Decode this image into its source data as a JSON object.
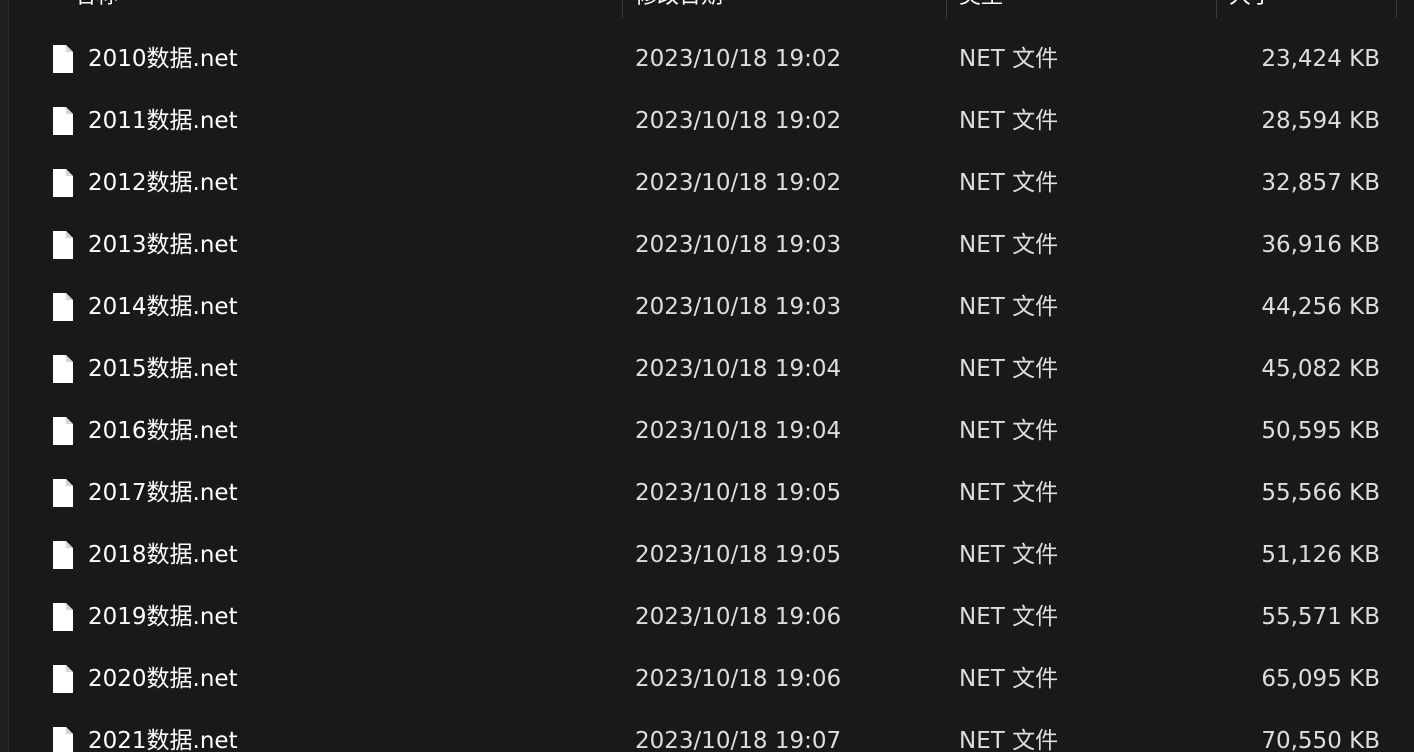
{
  "columns": {
    "name": "名称",
    "date": "修改日期",
    "type": "类型",
    "size": "大小"
  },
  "files": [
    {
      "name": "2010数据.net",
      "date": "2023/10/18 19:02",
      "type": "NET 文件",
      "size": "23,424 KB"
    },
    {
      "name": "2011数据.net",
      "date": "2023/10/18 19:02",
      "type": "NET 文件",
      "size": "28,594 KB"
    },
    {
      "name": "2012数据.net",
      "date": "2023/10/18 19:02",
      "type": "NET 文件",
      "size": "32,857 KB"
    },
    {
      "name": "2013数据.net",
      "date": "2023/10/18 19:03",
      "type": "NET 文件",
      "size": "36,916 KB"
    },
    {
      "name": "2014数据.net",
      "date": "2023/10/18 19:03",
      "type": "NET 文件",
      "size": "44,256 KB"
    },
    {
      "name": "2015数据.net",
      "date": "2023/10/18 19:04",
      "type": "NET 文件",
      "size": "45,082 KB"
    },
    {
      "name": "2016数据.net",
      "date": "2023/10/18 19:04",
      "type": "NET 文件",
      "size": "50,595 KB"
    },
    {
      "name": "2017数据.net",
      "date": "2023/10/18 19:05",
      "type": "NET 文件",
      "size": "55,566 KB"
    },
    {
      "name": "2018数据.net",
      "date": "2023/10/18 19:05",
      "type": "NET 文件",
      "size": "51,126 KB"
    },
    {
      "name": "2019数据.net",
      "date": "2023/10/18 19:06",
      "type": "NET 文件",
      "size": "55,571 KB"
    },
    {
      "name": "2020数据.net",
      "date": "2023/10/18 19:06",
      "type": "NET 文件",
      "size": "65,095 KB"
    },
    {
      "name": "2021数据.net",
      "date": "2023/10/18 19:07",
      "type": "NET 文件",
      "size": "70,550 KB"
    }
  ],
  "icons": {
    "file": "file-icon"
  },
  "colors": {
    "background": "#191919",
    "text": "#ffffff",
    "icon": "#ffffff"
  }
}
